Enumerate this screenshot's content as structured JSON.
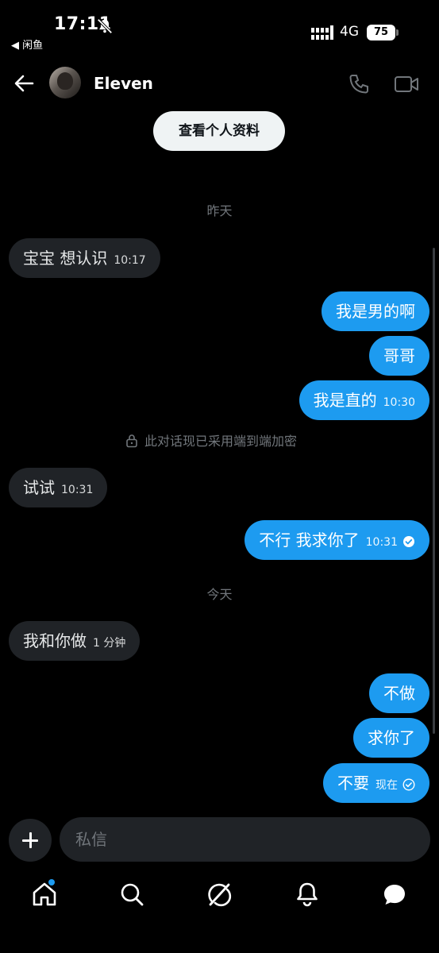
{
  "status_bar": {
    "time": "17:11",
    "back_app": "◀ 闲鱼",
    "network": "4G",
    "battery": "75"
  },
  "header": {
    "contact_name": "Eleven",
    "view_profile": "查看个人资料"
  },
  "conversation": {
    "date_yesterday": "昨天",
    "date_today": "今天",
    "encryption_notice": "此对话现已采用端到端加密",
    "messages": [
      {
        "dir": "in",
        "text": "宝宝 想认识",
        "time": "10:17"
      },
      {
        "dir": "out",
        "text": "我是男的啊",
        "time": ""
      },
      {
        "dir": "out",
        "text": "哥哥",
        "time": ""
      },
      {
        "dir": "out",
        "text": "我是直的",
        "time": "10:30"
      },
      {
        "dir": "in",
        "text": "试试",
        "time": "10:31"
      },
      {
        "dir": "out",
        "text": "不行 我求你了",
        "time": "10:31",
        "seen": true
      },
      {
        "dir": "in",
        "text": "我和你做",
        "time": "1 分钟"
      },
      {
        "dir": "out",
        "text": "不做",
        "time": ""
      },
      {
        "dir": "out",
        "text": "求你了",
        "time": ""
      },
      {
        "dir": "out",
        "text": "不要",
        "time": "现在",
        "seen": true
      }
    ]
  },
  "composer": {
    "placeholder": "私信"
  },
  "nav": {
    "items": [
      "home-icon",
      "search-icon",
      "grok-icon",
      "notifications-icon",
      "messages-icon"
    ],
    "accent": "#1d9bf0"
  },
  "colors": {
    "outgoing_bubble": "#1d9bf0",
    "incoming_bubble": "#202327",
    "background": "#000000"
  }
}
